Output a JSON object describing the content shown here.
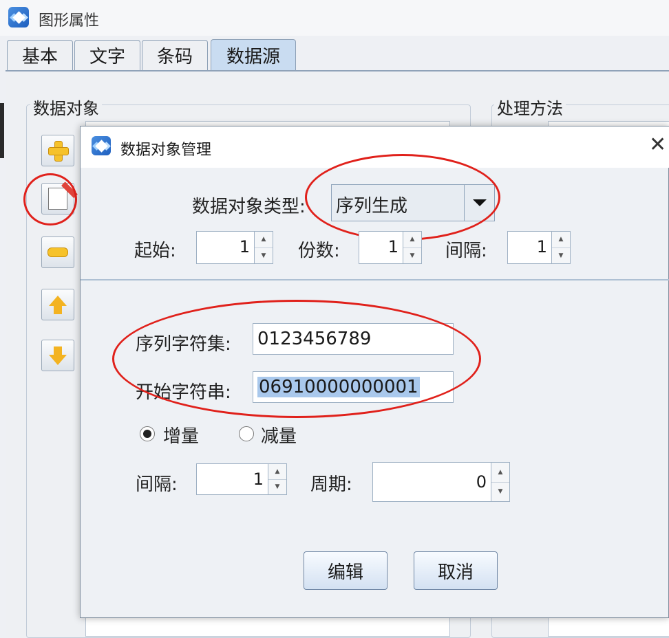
{
  "outer_window": {
    "title": "图形属性",
    "tabs": [
      {
        "label": "基本",
        "active": false
      },
      {
        "label": "文字",
        "active": false
      },
      {
        "label": "条码",
        "active": false
      },
      {
        "label": "数据源",
        "active": true
      }
    ],
    "group_left_title": "数据对象",
    "group_right_title": "处理方法",
    "side_buttons": [
      "add-icon",
      "edit-icon",
      "remove-icon",
      "move-up-icon",
      "move-down-icon"
    ]
  },
  "dialog": {
    "title": "数据对象管理",
    "close_glyph": "✕",
    "type_label": "数据对象类型:",
    "type_value": "序列生成",
    "start_label": "起始:",
    "start_value": "1",
    "copies_label": "份数:",
    "copies_value": "1",
    "interval_label": "间隔:",
    "interval_value": "1",
    "charset_label": "序列字符集:",
    "charset_value": "0123456789",
    "start_string_label": "开始字符串:",
    "start_string_value": "06910000000001",
    "increment_label": "增量",
    "increment_checked": true,
    "decrement_label": "减量",
    "decrement_checked": false,
    "step_interval_label": "间隔:",
    "step_interval_value": "1",
    "period_label": "周期:",
    "period_value": "0",
    "edit_button": "编辑",
    "cancel_button": "取消"
  },
  "colors": {
    "highlight_ellipse": "#e0211b",
    "selection": "#a9c8ec",
    "active_tab": "#c9dcf1"
  }
}
